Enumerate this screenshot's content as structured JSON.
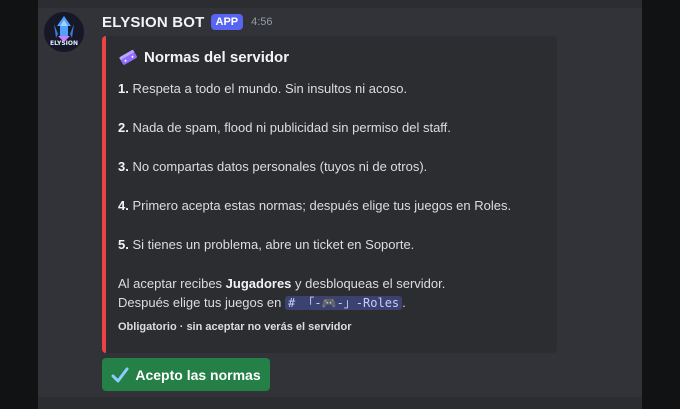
{
  "message": {
    "author": "ELYSION BOT",
    "badge": "APP",
    "timestamp": "4:56",
    "avatar_icon": "elysion-logo-icon",
    "avatar_text": "ELYSION"
  },
  "embed": {
    "accent_color": "#ed4245",
    "title_icon": "ticket-icon",
    "title": "Normas del servidor",
    "rules": [
      {
        "num": "1.",
        "text": " Respeta a todo el mundo. Sin insultos ni acoso."
      },
      {
        "num": "2.",
        "text": " Nada de spam, flood ni publicidad sin permiso del staff."
      },
      {
        "num": "3.",
        "text": " No compartas datos personales (tuyos ni de otros)."
      },
      {
        "num": "4.",
        "text": " Primero acepta estas normas; después elige tus juegos en Roles."
      },
      {
        "num": "5.",
        "text": " Si tienes un problema, abre un ticket en Soporte."
      }
    ],
    "outro_prefix": "Al aceptar recibes ",
    "outro_bold": "Jugadores",
    "outro_suffix": " y desbloqueas el servidor.",
    "outro_line2_prefix": "Después elige tus juegos en ",
    "channel_mention": "# 「-🎮-」-Roles",
    "outro_line2_suffix": ".",
    "footer": "Obligatorio · sin aceptar no verás el servidor"
  },
  "button": {
    "icon": "check-mark-icon",
    "label": "Acepto las normas",
    "color": "#248046"
  }
}
